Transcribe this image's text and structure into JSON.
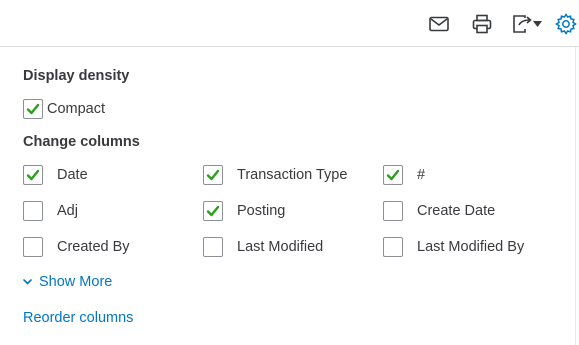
{
  "toolbar": {
    "icons": [
      "email-icon",
      "print-icon",
      "export-icon",
      "chevron-down-icon",
      "settings-gear-icon"
    ]
  },
  "display_density": {
    "title": "Display density",
    "compact": {
      "label": "Compact",
      "checked": true
    }
  },
  "change_columns": {
    "title": "Change columns",
    "columns": [
      {
        "label": "Date",
        "checked": true
      },
      {
        "label": "Transaction Type",
        "checked": true
      },
      {
        "label": "#",
        "checked": true
      },
      {
        "label": "Adj",
        "checked": false
      },
      {
        "label": "Posting",
        "checked": true
      },
      {
        "label": "Create Date",
        "checked": false
      },
      {
        "label": "Created By",
        "checked": false
      },
      {
        "label": "Last Modified",
        "checked": false
      },
      {
        "label": "Last Modified By",
        "checked": false
      }
    ]
  },
  "show_more_label": "Show More",
  "reorder_label": "Reorder columns",
  "colors": {
    "accent": "#0077c5",
    "check": "#2ca01c",
    "text": "#393a3d"
  }
}
